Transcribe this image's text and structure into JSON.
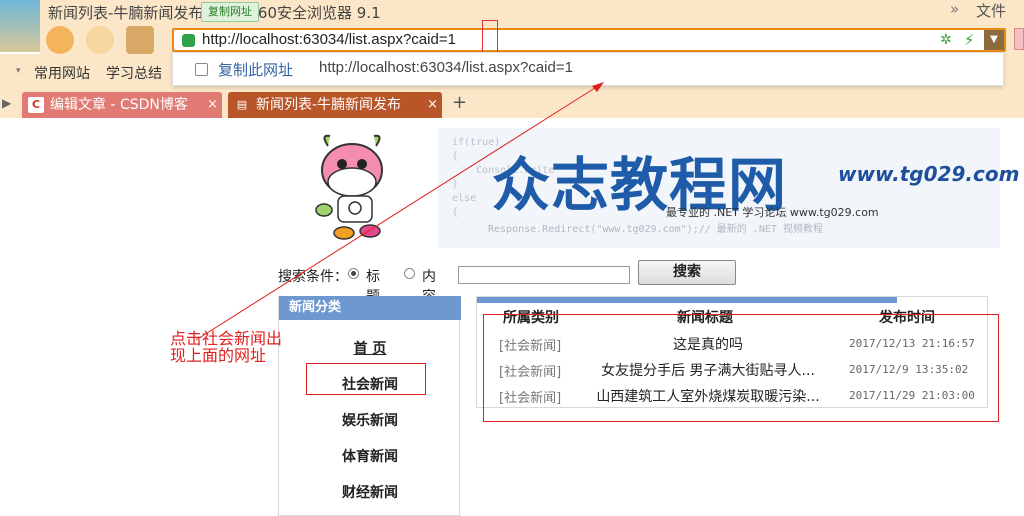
{
  "browser": {
    "window_title": "新闻列表-牛腩新闻发布系统 - 360安全浏览器 9.1",
    "copy_url_badge": "复制网址",
    "file_menu": "文件",
    "more_chevron": "»",
    "address_url": "http://localhost:63034/list.aspx?caid=1",
    "suggestion": {
      "label": "复制此网址",
      "url": "http://localhost:63034/list.aspx?caid=1"
    },
    "bookmarks": [
      "常用网站",
      "学习总结"
    ],
    "tabs": [
      {
        "label": "编辑文章 - CSDN博客",
        "icon": "csdn-icon",
        "icon_glyph": "C"
      },
      {
        "label": "新闻列表-牛腩新闻发布",
        "icon": "page-icon",
        "icon_glyph": "▤"
      }
    ],
    "tab_close": "×",
    "new_tab": "+",
    "accent_color": "#e88a14"
  },
  "banner": {
    "code": "if(true)\n{\n    Console.Write\n}\nelse\n{\n",
    "brand": "众志教程网",
    "site": "www.tg029.com",
    "slogan": "最专业的 .NET 学习论坛  www.tg029.com",
    "tail": "Response.Redirect(\"www.tg029.com\");// 最新的 .NET 视频教程"
  },
  "search": {
    "label": "搜索条件：",
    "option_title": "标题",
    "option_content": "内容",
    "selected": "标题",
    "input_value": "",
    "button": "搜索"
  },
  "sidebar": {
    "header": "新闻分类",
    "items": [
      "首 页",
      "社会新闻",
      "娱乐新闻",
      "体育新闻",
      "财经新闻"
    ]
  },
  "table": {
    "headers": [
      "所属类别",
      "新闻标题",
      "发布时间"
    ],
    "rows": [
      {
        "category": "[社会新闻]",
        "title": "这是真的吗",
        "time": "2017/12/13 21:16:57"
      },
      {
        "category": "[社会新闻]",
        "title": "女友提分手后 男子满大街贴寻人...",
        "time": "2017/12/9 13:35:02"
      },
      {
        "category": "[社会新闻]",
        "title": "山西建筑工人室外烧煤炭取暖污染...",
        "time": "2017/11/29 21:03:00"
      }
    ]
  },
  "annotation": {
    "note": "点击社会新闻出现上面的网址",
    "color": "#e02020"
  }
}
